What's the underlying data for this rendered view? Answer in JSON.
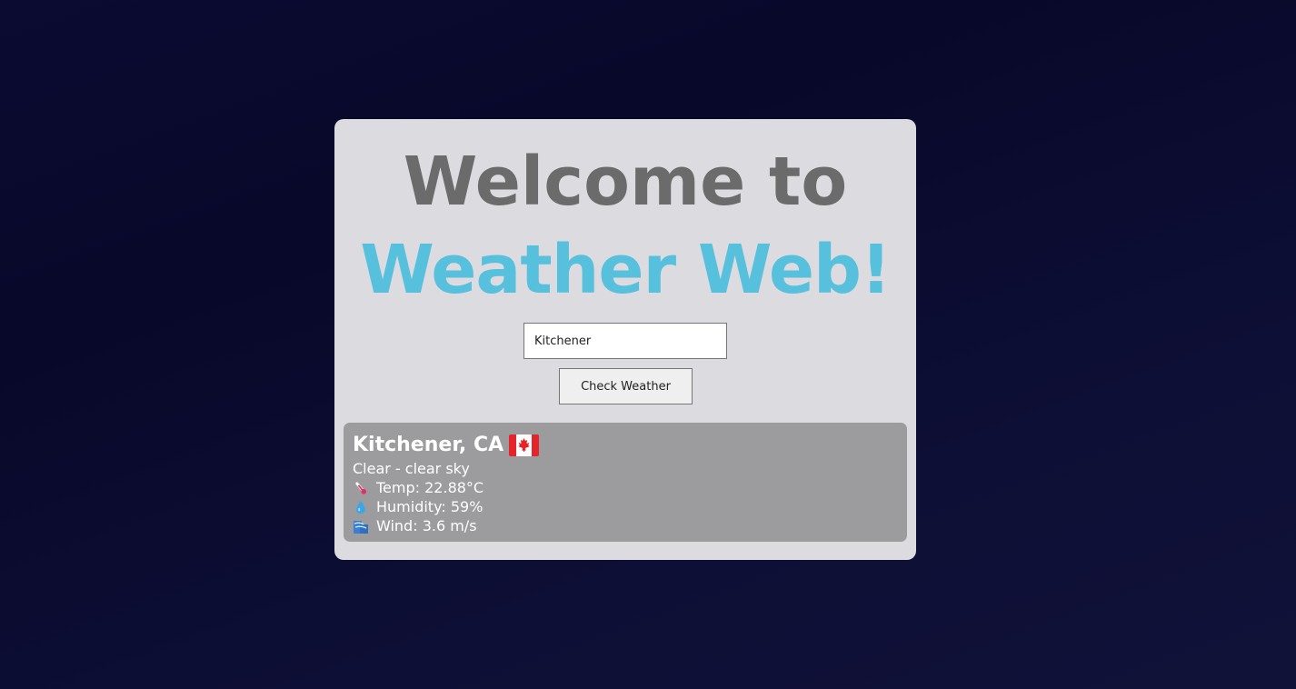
{
  "header": {
    "line1": "Welcome to",
    "line2": "Weather Web!"
  },
  "search": {
    "value": "Kitchener",
    "button_label": "Check Weather"
  },
  "result": {
    "city": "Kitchener, CA",
    "flag_icon": "canada-flag-icon",
    "description": "Clear - clear sky",
    "temp_icon": "thermometer-icon",
    "temp": "Temp: 22.88°C",
    "humidity_icon": "droplet-icon",
    "humidity": "Humidity: 59%",
    "wind_icon": "wind-icon",
    "wind": "Wind: 3.6 m/s"
  },
  "colors": {
    "background": "#0b0b32",
    "card": "#dcdbe0",
    "title_gray": "#6c6b6b",
    "title_accent": "#56c0dd",
    "result_panel": "#9c9c9f"
  }
}
